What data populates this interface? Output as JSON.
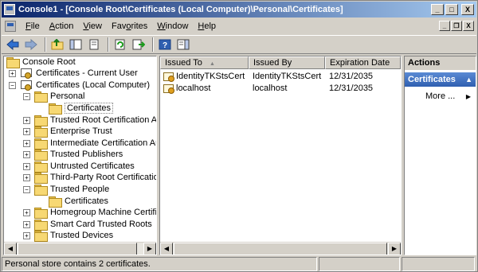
{
  "window": {
    "title": "Console1 - [Console Root\\Certificates (Local Computer)\\Personal\\Certificates]",
    "buttons": {
      "minimize": "_",
      "maximize": "□",
      "close": "X"
    },
    "mdi_buttons": {
      "minimize": "_",
      "restore": "❐",
      "close": "X"
    }
  },
  "menubar": {
    "items": [
      {
        "label": "File",
        "u": "F",
        "rest": "ile"
      },
      {
        "label": "Action",
        "u": "A",
        "rest": "ction"
      },
      {
        "label": "View",
        "u": "V",
        "rest": "iew"
      },
      {
        "label": "Favorites",
        "pre": "Fav",
        "u": "o",
        "rest": "rites"
      },
      {
        "label": "Window",
        "u": "W",
        "rest": "indow"
      },
      {
        "label": "Help",
        "u": "H",
        "rest": "elp"
      }
    ]
  },
  "toolbar": {
    "icons": [
      "back-icon",
      "forward-icon",
      "up-folder-icon",
      "show-hide-tree-icon",
      "copy-icon",
      "refresh-icon",
      "export-list-icon",
      "help-icon",
      "show-hide-action-pane-icon"
    ]
  },
  "tree": {
    "items": [
      {
        "label": "Console Root",
        "type": "folder",
        "expander": ""
      },
      {
        "label": "Certificates - Current User",
        "type": "store",
        "expander": "+"
      },
      {
        "label": "Certificates (Local Computer)",
        "type": "store",
        "expander": "−"
      },
      {
        "label": "Personal",
        "type": "folder",
        "expander": "−"
      },
      {
        "label": "Certificates",
        "type": "folder",
        "expander": "",
        "selected": true
      },
      {
        "label": "Trusted Root Certification Auth",
        "type": "folder",
        "expander": "+"
      },
      {
        "label": "Enterprise Trust",
        "type": "folder",
        "expander": "+"
      },
      {
        "label": "Intermediate Certification Auth",
        "type": "folder",
        "expander": "+"
      },
      {
        "label": "Trusted Publishers",
        "type": "folder",
        "expander": "+"
      },
      {
        "label": "Untrusted Certificates",
        "type": "folder",
        "expander": "+"
      },
      {
        "label": "Third-Party Root Certification A",
        "type": "folder",
        "expander": "+"
      },
      {
        "label": "Trusted People",
        "type": "folder",
        "expander": "−"
      },
      {
        "label": "Certificates",
        "type": "folder",
        "expander": ""
      },
      {
        "label": "Homegroup Machine Certificate",
        "type": "folder",
        "expander": "+"
      },
      {
        "label": "Smart Card Trusted Roots",
        "type": "folder",
        "expander": "+"
      },
      {
        "label": "Trusted Devices",
        "type": "folder",
        "expander": "+"
      }
    ]
  },
  "list": {
    "columns": [
      "Issued To",
      "Issued By",
      "Expiration Date"
    ],
    "sort_arrow": "▲",
    "rows": [
      {
        "issued_to": "IdentityTKStsCert",
        "issued_by": "IdentityTKStsCert",
        "expires": "12/31/2035"
      },
      {
        "issued_to": "localhost",
        "issued_by": "localhost",
        "expires": "12/31/2035"
      }
    ]
  },
  "actions": {
    "header": "Actions",
    "group": "Certificates",
    "group_arrow": "▲",
    "more": "More ...",
    "more_arrow": "▶"
  },
  "status": {
    "text": "Personal store contains 2 certificates."
  },
  "scroll": {
    "left": "◀",
    "right": "▶"
  }
}
